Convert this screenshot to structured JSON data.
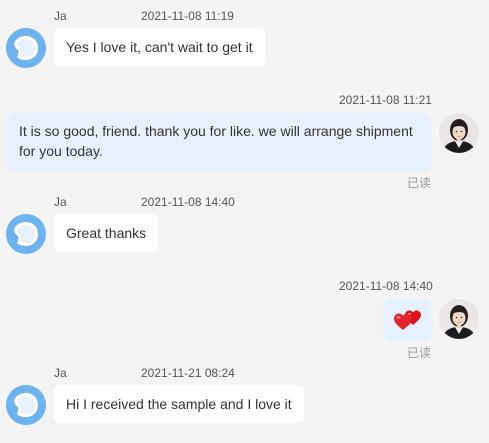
{
  "messages": [
    {
      "direction": "in",
      "sender": "Ja",
      "time": "2021-11-08 11:19",
      "text": "Yes I love it, can't wait to get it"
    },
    {
      "direction": "out",
      "time": "2021-11-08 11:21",
      "text": "It is so good, friend. thank you for like. we will arrange shipment for you today.",
      "status": "已读"
    },
    {
      "direction": "in",
      "sender": "Ja",
      "time": "2021-11-08 14:40",
      "text": "Great thanks"
    },
    {
      "direction": "out",
      "time": "2021-11-08 14:40",
      "sticker": "hearts-emoji",
      "status": "已读"
    },
    {
      "direction": "in",
      "sender": "Ja",
      "time": "2021-11-21 08:24",
      "text": "Hi I received the sample and I love it"
    }
  ],
  "colors": {
    "page_background": "#f4f4f5",
    "incoming_bubble": "#ffffff",
    "outgoing_bubble": "#e6f1fd",
    "bot_avatar": "#6fb3ee",
    "read_status": "#999999"
  }
}
